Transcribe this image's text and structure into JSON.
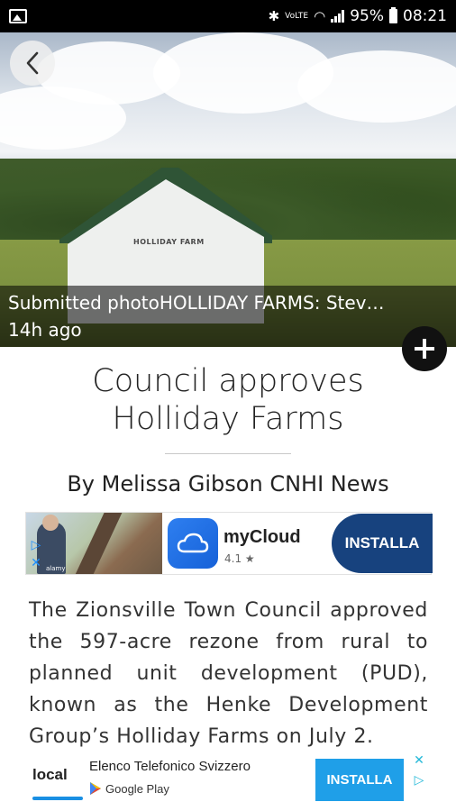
{
  "status_bar": {
    "network_text": "VoLTE",
    "battery_percent": "95%",
    "time": "08:21"
  },
  "hero": {
    "caption": "Submitted photoHOLLIDAY FARMS: Stev…",
    "timestamp": "14h ago",
    "barn_sign": "HOLLIDAY FARM"
  },
  "article": {
    "headline": "Council approves Holliday Farms",
    "byline": "By Melissa Gibson CNHI News",
    "body": "The Zionsville Town Council approved the 597-acre rezone from rural to planned unit development (PUD), known as the Henke Development Group’s Holliday Farms on July 2."
  },
  "ad_top": {
    "app_name": "myCloud",
    "rating": "4.1 ★",
    "cta": "INSTALLA",
    "photo_watermark": "alamy"
  },
  "ad_bottom": {
    "logo": "local",
    "title": "Elenco Telefonico Svizzero",
    "store": "Google Play",
    "cta": "INSTALLA"
  },
  "ad_badges": {
    "adchoices": "▷",
    "close": "✕"
  },
  "colors": {
    "ad_top_cta": "#17427e",
    "ad_bottom_cta": "#1f9fe8",
    "adchoices_blue": "#1e90ff"
  }
}
